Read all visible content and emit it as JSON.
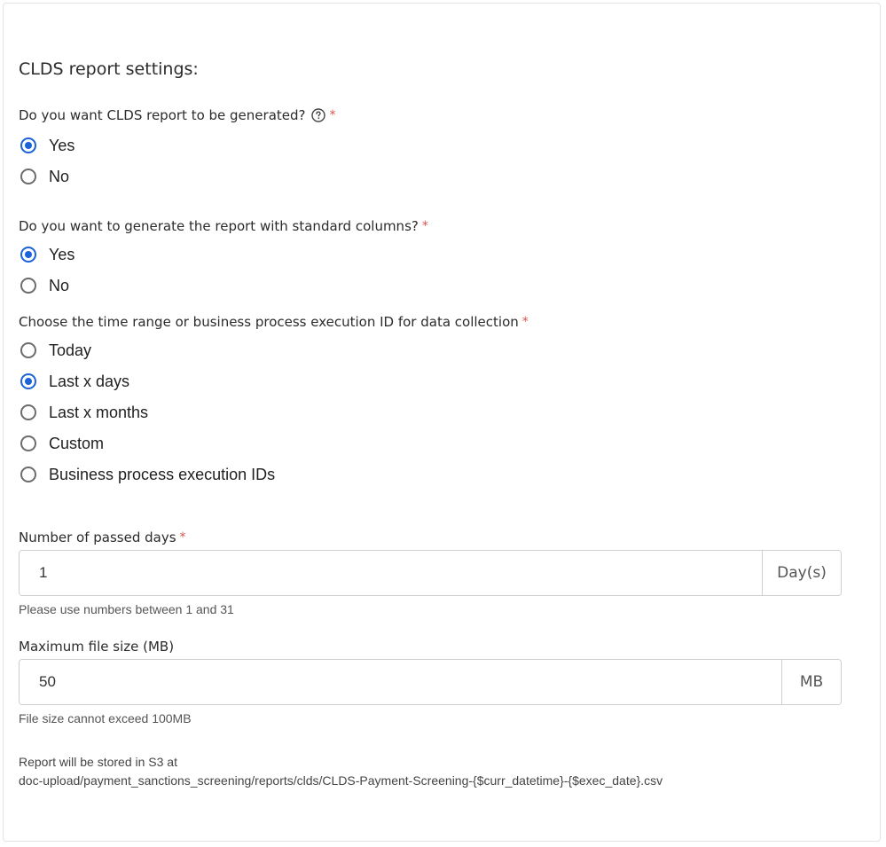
{
  "section_title": "CLDS report settings:",
  "q_generate": {
    "label": "Do you want CLDS report to be generated?",
    "required_mark": "*",
    "options": [
      {
        "label": "Yes",
        "checked": true
      },
      {
        "label": "No",
        "checked": false
      }
    ]
  },
  "q_standard_columns": {
    "label": "Do you want to generate the report with standard columns?",
    "required_mark": "*",
    "options": [
      {
        "label": "Yes",
        "checked": true
      },
      {
        "label": "No",
        "checked": false
      }
    ]
  },
  "q_time_range": {
    "label": "Choose the time range or business process execution ID for data collection",
    "required_mark": "*",
    "options": [
      {
        "label": "Today",
        "checked": false
      },
      {
        "label": "Last x days",
        "checked": true
      },
      {
        "label": "Last x months",
        "checked": false
      },
      {
        "label": "Custom",
        "checked": false
      },
      {
        "label": "Business process execution IDs",
        "checked": false
      }
    ]
  },
  "passed_days": {
    "label": "Number of passed days",
    "required_mark": "*",
    "value": "1",
    "addon": "Day(s)",
    "help": "Please use numbers between 1 and 31"
  },
  "max_file_size": {
    "label": "Maximum file size (MB)",
    "value": "50",
    "addon": "MB",
    "help": "File size cannot exceed 100MB"
  },
  "storage_note": {
    "line1": "Report will be stored in S3 at",
    "line2": "doc-upload/payment_sanctions_screening/reports/clds/CLDS-Payment-Screening-{$curr_datetime}-{$exec_date}.csv"
  },
  "colors": {
    "accent": "#1c62d8",
    "required": "#d9534f"
  },
  "icons": {
    "help": "question-circle-icon"
  }
}
